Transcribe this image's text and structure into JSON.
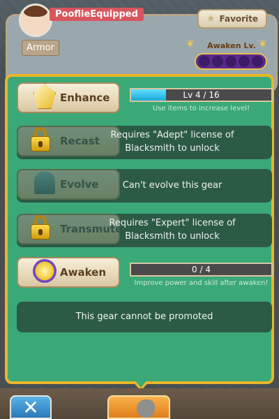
{
  "header": {
    "username": "PooflieEquipped",
    "favorite_label": "Favorite",
    "category": "Armor",
    "awaken_label": "Awaken Lv.",
    "awaken_level": 0,
    "awaken_max": 5
  },
  "enhance": {
    "label": "Enhance",
    "progress_text": "Lv 4 / 16",
    "progress_fraction": 0.25,
    "hint": "Use items to increase level!"
  },
  "recast": {
    "label": "Recast",
    "lock_text_1": "Requires \"Adept\" license of",
    "lock_text_2": "Blacksmith to unlock"
  },
  "evolve": {
    "label": "Evolve",
    "status": "Can't evolve this gear"
  },
  "transmute": {
    "label": "Transmute",
    "lock_text_1": "Requires \"Expert\" license of",
    "lock_text_2": "Blacksmith to unlock"
  },
  "awaken": {
    "label": "Awaken",
    "progress_text": "0 / 4",
    "progress_fraction": 0,
    "hint": "Improve power and skill after awaken!"
  },
  "promote": {
    "status": "This gear cannot be promoted"
  },
  "bottom": {
    "close_symbol": "✕"
  },
  "colors": {
    "panel": "#3aa977",
    "panel_border": "#e8b62a",
    "row_dark": "#2b5a45",
    "progress_fill": "#1aa8d8"
  }
}
